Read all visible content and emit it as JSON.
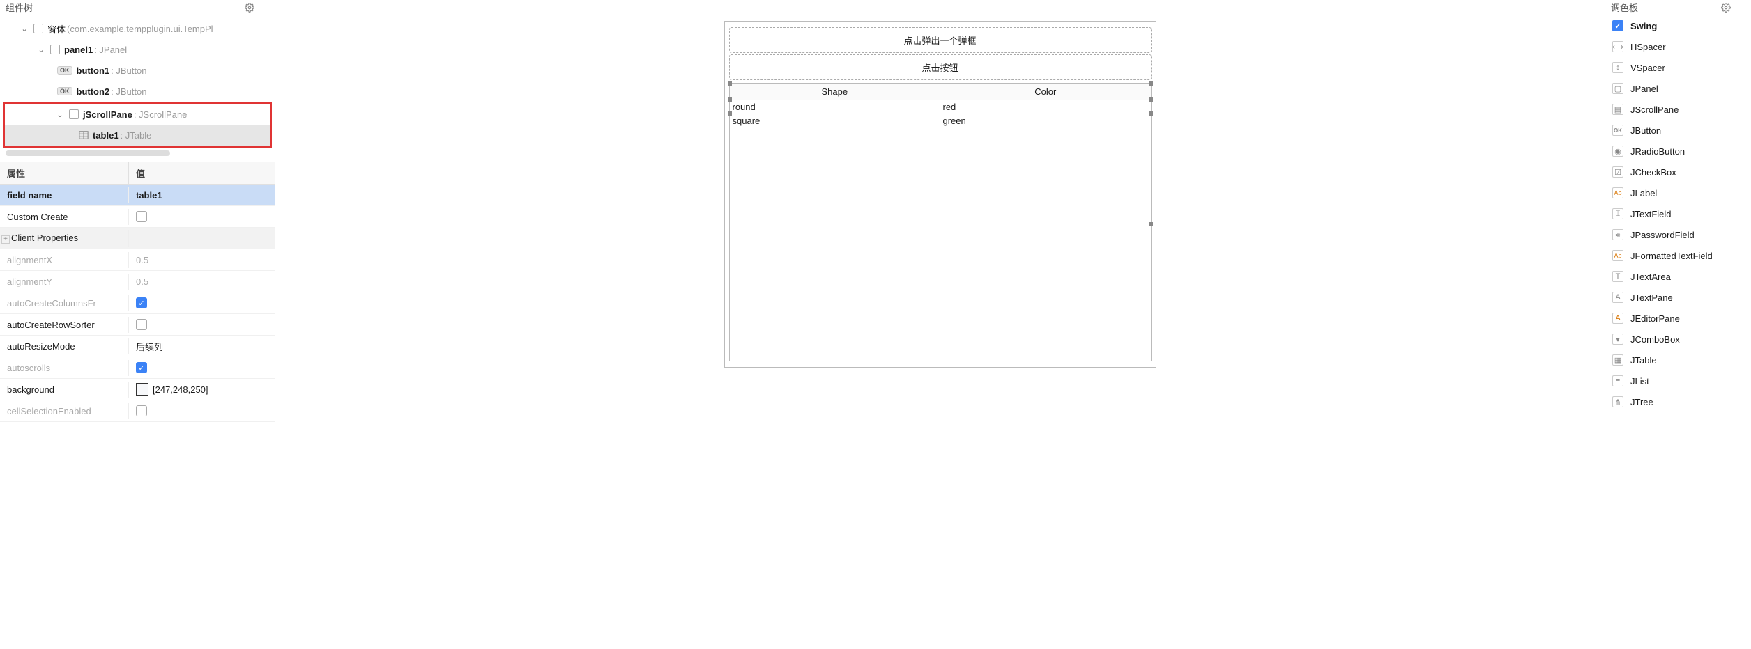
{
  "leftPanel": {
    "title": "组件树",
    "tree": {
      "root": {
        "label": "窗体",
        "type": "(com.example.tempplugin.ui.TempPl"
      },
      "panel1": {
        "label": "panel1",
        "type": ": JPanel"
      },
      "button1": {
        "label": "button1",
        "type": ": JButton"
      },
      "button2": {
        "label": "button2",
        "type": ": JButton"
      },
      "jScrollPane": {
        "label": "jScrollPane",
        "type": ": JScrollPane"
      },
      "table1": {
        "label": "table1",
        "type": ": JTable"
      }
    },
    "props": {
      "headerName": "属性",
      "headerValue": "值",
      "rows": {
        "fieldName": {
          "name": "field name",
          "value": "table1"
        },
        "customCreate": {
          "name": "Custom Create"
        },
        "clientProps": {
          "name": "Client Properties"
        },
        "alignmentX": {
          "name": "alignmentX",
          "value": "0.5"
        },
        "alignmentY": {
          "name": "alignmentY",
          "value": "0.5"
        },
        "autoCreateColumns": {
          "name": "autoCreateColumnsFr"
        },
        "autoCreateRowSorter": {
          "name": "autoCreateRowSorter"
        },
        "autoResizeMode": {
          "name": "autoResizeMode",
          "value": "后续列"
        },
        "autoscrolls": {
          "name": "autoscrolls"
        },
        "background": {
          "name": "background",
          "value": "[247,248,250]"
        },
        "cellSelection": {
          "name": "cellSelectionEnabled"
        }
      }
    }
  },
  "center": {
    "btn1": "点击弹出一个弹框",
    "btn2": "点击按钮",
    "table": {
      "headers": [
        "Shape",
        "Color"
      ],
      "rows": [
        [
          "round",
          "red"
        ],
        [
          "square",
          "green"
        ]
      ]
    }
  },
  "rightPanel": {
    "title": "调色板",
    "swing": "Swing",
    "items": {
      "hspacer": "HSpacer",
      "vspacer": "VSpacer",
      "jpanel": "JPanel",
      "jscrollpane": "JScrollPane",
      "jbutton": "JButton",
      "jradiobutton": "JRadioButton",
      "jcheckbox": "JCheckBox",
      "jlabel": "JLabel",
      "jtextfield": "JTextField",
      "jpasswordfield": "JPasswordField",
      "jformattedtextfield": "JFormattedTextField",
      "jtextarea": "JTextArea",
      "jtextpane": "JTextPane",
      "jeditorpane": "JEditorPane",
      "jcombobox": "JComboBox",
      "jtable": "JTable",
      "jlist": "JList",
      "jtree": "JTree"
    }
  }
}
